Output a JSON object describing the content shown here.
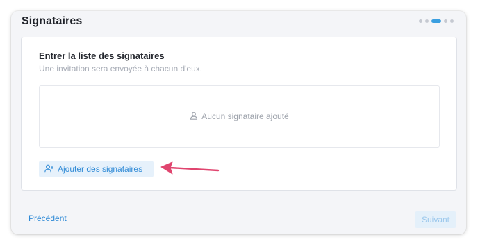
{
  "window": {
    "title": "Signataires"
  },
  "stepper": {
    "current_step": 3,
    "total_steps": 5
  },
  "card": {
    "title": "Entrer la liste des signataires",
    "subtitle": "Une invitation sera envoyée à chacun d'eux.",
    "empty_state": "Aucun signataire ajouté",
    "add_button_label": "Ajouter des signataires"
  },
  "footer": {
    "previous_label": "Précédent",
    "next_label": "Suivant"
  },
  "colors": {
    "accent": "#2f8ad6",
    "annotation_arrow": "#e0456f"
  },
  "icons": {
    "empty_state": "user-icon",
    "add_button": "user-plus-icon"
  }
}
